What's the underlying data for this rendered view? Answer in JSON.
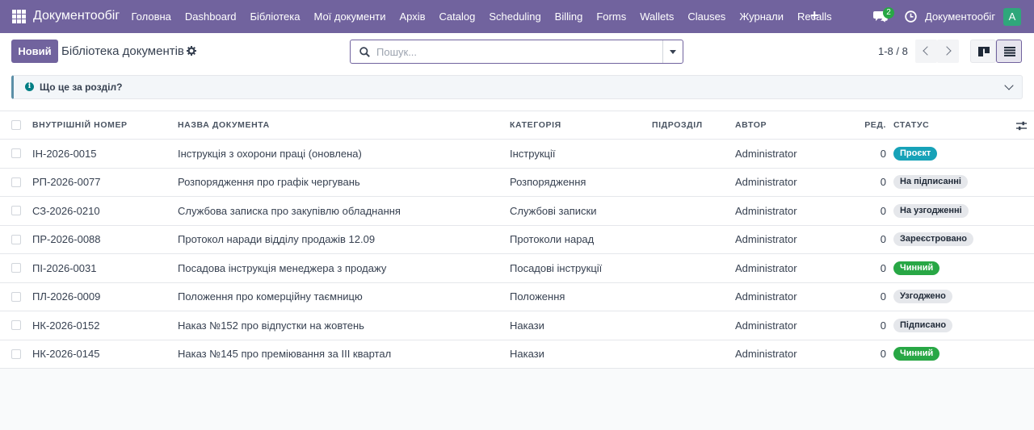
{
  "navbar": {
    "app_name": "Документообіг",
    "menu": [
      "Головна",
      "Dashboard",
      "Бібліотека",
      "Мої документи",
      "Архів",
      "Catalog",
      "Scheduling",
      "Billing",
      "Forms",
      "Wallets",
      "Clauses",
      "Журнали",
      "Recalls"
    ],
    "chat_count": "2",
    "user_name": "Документообіг",
    "avatar_letter": "A"
  },
  "control": {
    "new_label": "Новий",
    "title": "Бібліотека документів",
    "search_placeholder": "Пошук...",
    "pager": "1-8 / 8"
  },
  "help": {
    "text": "Що це за розділ?"
  },
  "table": {
    "columns": [
      "ВНУТРІШНІЙ НОМЕР",
      "НАЗВА ДОКУМЕНТА",
      "КАТЕГОРІЯ",
      "ПІДРОЗДІЛ",
      "АВТОР",
      "РЕД.",
      "СТАТУС"
    ],
    "rows": [
      {
        "number": "ІН-2026-0015",
        "name": "Інструкція з охорони праці (оновлена)",
        "category": "Інструкції",
        "department": "",
        "author": "Administrator",
        "rev": "0",
        "status": "Проєкт",
        "status_bg": "#17a2b8",
        "status_fg": "#ffffff"
      },
      {
        "number": "РП-2026-0077",
        "name": "Розпорядження про графік чергувань",
        "category": "Розпорядження",
        "department": "",
        "author": "Administrator",
        "rev": "0",
        "status": "На підписанні",
        "status_bg": "#e5e7eb",
        "status_fg": "#1f2937"
      },
      {
        "number": "СЗ-2026-0210",
        "name": "Службова записка про закупівлю обладнання",
        "category": "Службові записки",
        "department": "",
        "author": "Administrator",
        "rev": "0",
        "status": "На узгодженні",
        "status_bg": "#e5e7eb",
        "status_fg": "#1f2937"
      },
      {
        "number": "ПР-2026-0088",
        "name": "Протокол наради відділу продажів 12.09",
        "category": "Протоколи нарад",
        "department": "",
        "author": "Administrator",
        "rev": "0",
        "status": "Зареєстровано",
        "status_bg": "#e5e7eb",
        "status_fg": "#1f2937"
      },
      {
        "number": "ПІ-2026-0031",
        "name": "Посадова інструкція менеджера з продажу",
        "category": "Посадові інструкції",
        "department": "",
        "author": "Administrator",
        "rev": "0",
        "status": "Чинний",
        "status_bg": "#28a745",
        "status_fg": "#ffffff"
      },
      {
        "number": "ПЛ-2026-0009",
        "name": "Положення про комерційну таємницю",
        "category": "Положення",
        "department": "",
        "author": "Administrator",
        "rev": "0",
        "status": "Узгоджено",
        "status_bg": "#e5e7eb",
        "status_fg": "#1f2937"
      },
      {
        "number": "НК-2026-0152",
        "name": "Наказ №152 про відпустки на жовтень",
        "category": "Накази",
        "department": "",
        "author": "Administrator",
        "rev": "0",
        "status": "Підписано",
        "status_bg": "#e5e7eb",
        "status_fg": "#1f2937"
      },
      {
        "number": "НК-2026-0145",
        "name": "Наказ №145 про преміювання за III квартал",
        "category": "Накази",
        "department": "",
        "author": "Administrator",
        "rev": "0",
        "status": "Чинний",
        "status_bg": "#28a745",
        "status_fg": "#ffffff"
      }
    ]
  },
  "colors": {
    "brand": "#71639e",
    "draft": "#17a2b8",
    "active": "#28a745"
  },
  "icons": [
    "apps-grid-icon",
    "plus-icon",
    "chat-icon",
    "clock-icon",
    "gear-icon",
    "search-icon",
    "chevron-left-icon",
    "chevron-right-icon",
    "kanban-view-icon",
    "list-view-icon",
    "info-icon",
    "chevron-down-icon",
    "optional-columns-icon"
  ]
}
